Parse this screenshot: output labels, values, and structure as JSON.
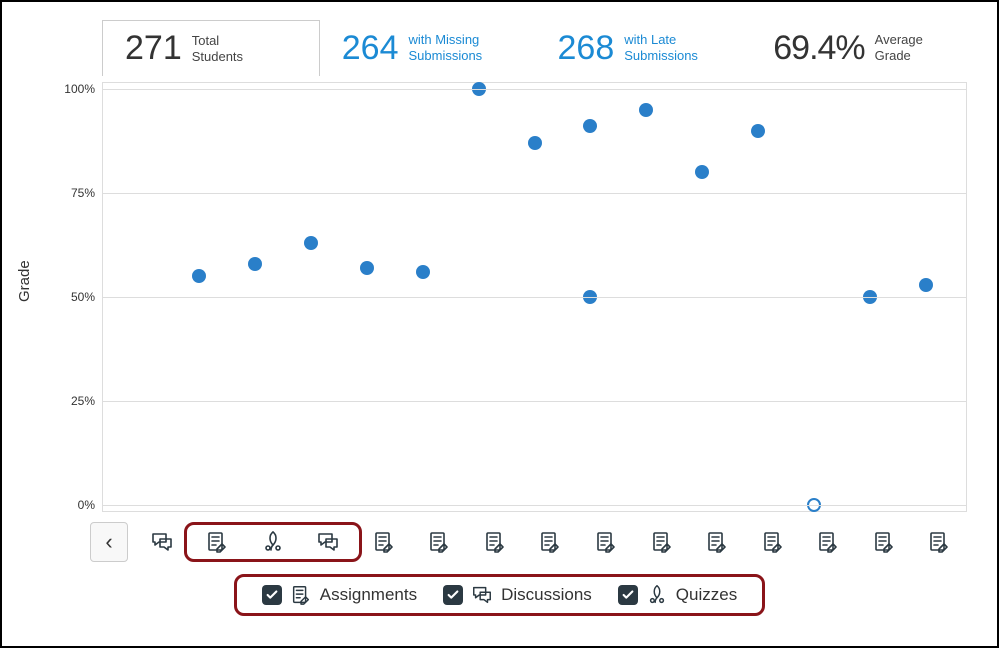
{
  "stats": {
    "total": {
      "value": "271",
      "label1": "Total",
      "label2": "Students"
    },
    "missing": {
      "value": "264",
      "label1": "with Missing",
      "label2": "Submissions"
    },
    "late": {
      "value": "268",
      "label1": "with Late",
      "label2": "Submissions"
    },
    "avg": {
      "value": "69.4%",
      "label1": "Average",
      "label2": "Grade"
    }
  },
  "chart_data": {
    "type": "scatter",
    "ylabel": "Grade",
    "ylim": [
      0,
      100
    ],
    "y_ticks": [
      "0%",
      "25%",
      "50%",
      "75%",
      "100%"
    ],
    "x_categories": [
      {
        "type": "discussion"
      },
      {
        "type": "assignment"
      },
      {
        "type": "quiz"
      },
      {
        "type": "discussion"
      },
      {
        "type": "assignment"
      },
      {
        "type": "assignment"
      },
      {
        "type": "assignment"
      },
      {
        "type": "assignment"
      },
      {
        "type": "assignment"
      },
      {
        "type": "assignment"
      },
      {
        "type": "assignment"
      },
      {
        "type": "assignment"
      },
      {
        "type": "assignment"
      },
      {
        "type": "assignment"
      },
      {
        "type": "assignment"
      }
    ],
    "points": [
      {
        "x": 1,
        "y": 55,
        "open": false
      },
      {
        "x": 2,
        "y": 58,
        "open": false
      },
      {
        "x": 3,
        "y": 63,
        "open": false
      },
      {
        "x": 4,
        "y": 57,
        "open": false
      },
      {
        "x": 5,
        "y": 56,
        "open": false
      },
      {
        "x": 6,
        "y": 100,
        "open": false
      },
      {
        "x": 7,
        "y": 87,
        "open": false
      },
      {
        "x": 8,
        "y": 91,
        "open": false
      },
      {
        "x": 8,
        "y": 50,
        "open": false
      },
      {
        "x": 9,
        "y": 95,
        "open": false
      },
      {
        "x": 10,
        "y": 80,
        "open": false
      },
      {
        "x": 11,
        "y": 90,
        "open": false
      },
      {
        "x": 12,
        "y": 0,
        "open": true
      },
      {
        "x": 13,
        "y": 50,
        "open": false
      },
      {
        "x": 14,
        "y": 53,
        "open": false
      }
    ]
  },
  "legend": {
    "assignments": {
      "label": "Assignments",
      "checked": true
    },
    "discussions": {
      "label": "Discussions",
      "checked": true
    },
    "quizzes": {
      "label": "Quizzes",
      "checked": true
    }
  },
  "nav": {
    "prev_glyph": "‹"
  }
}
